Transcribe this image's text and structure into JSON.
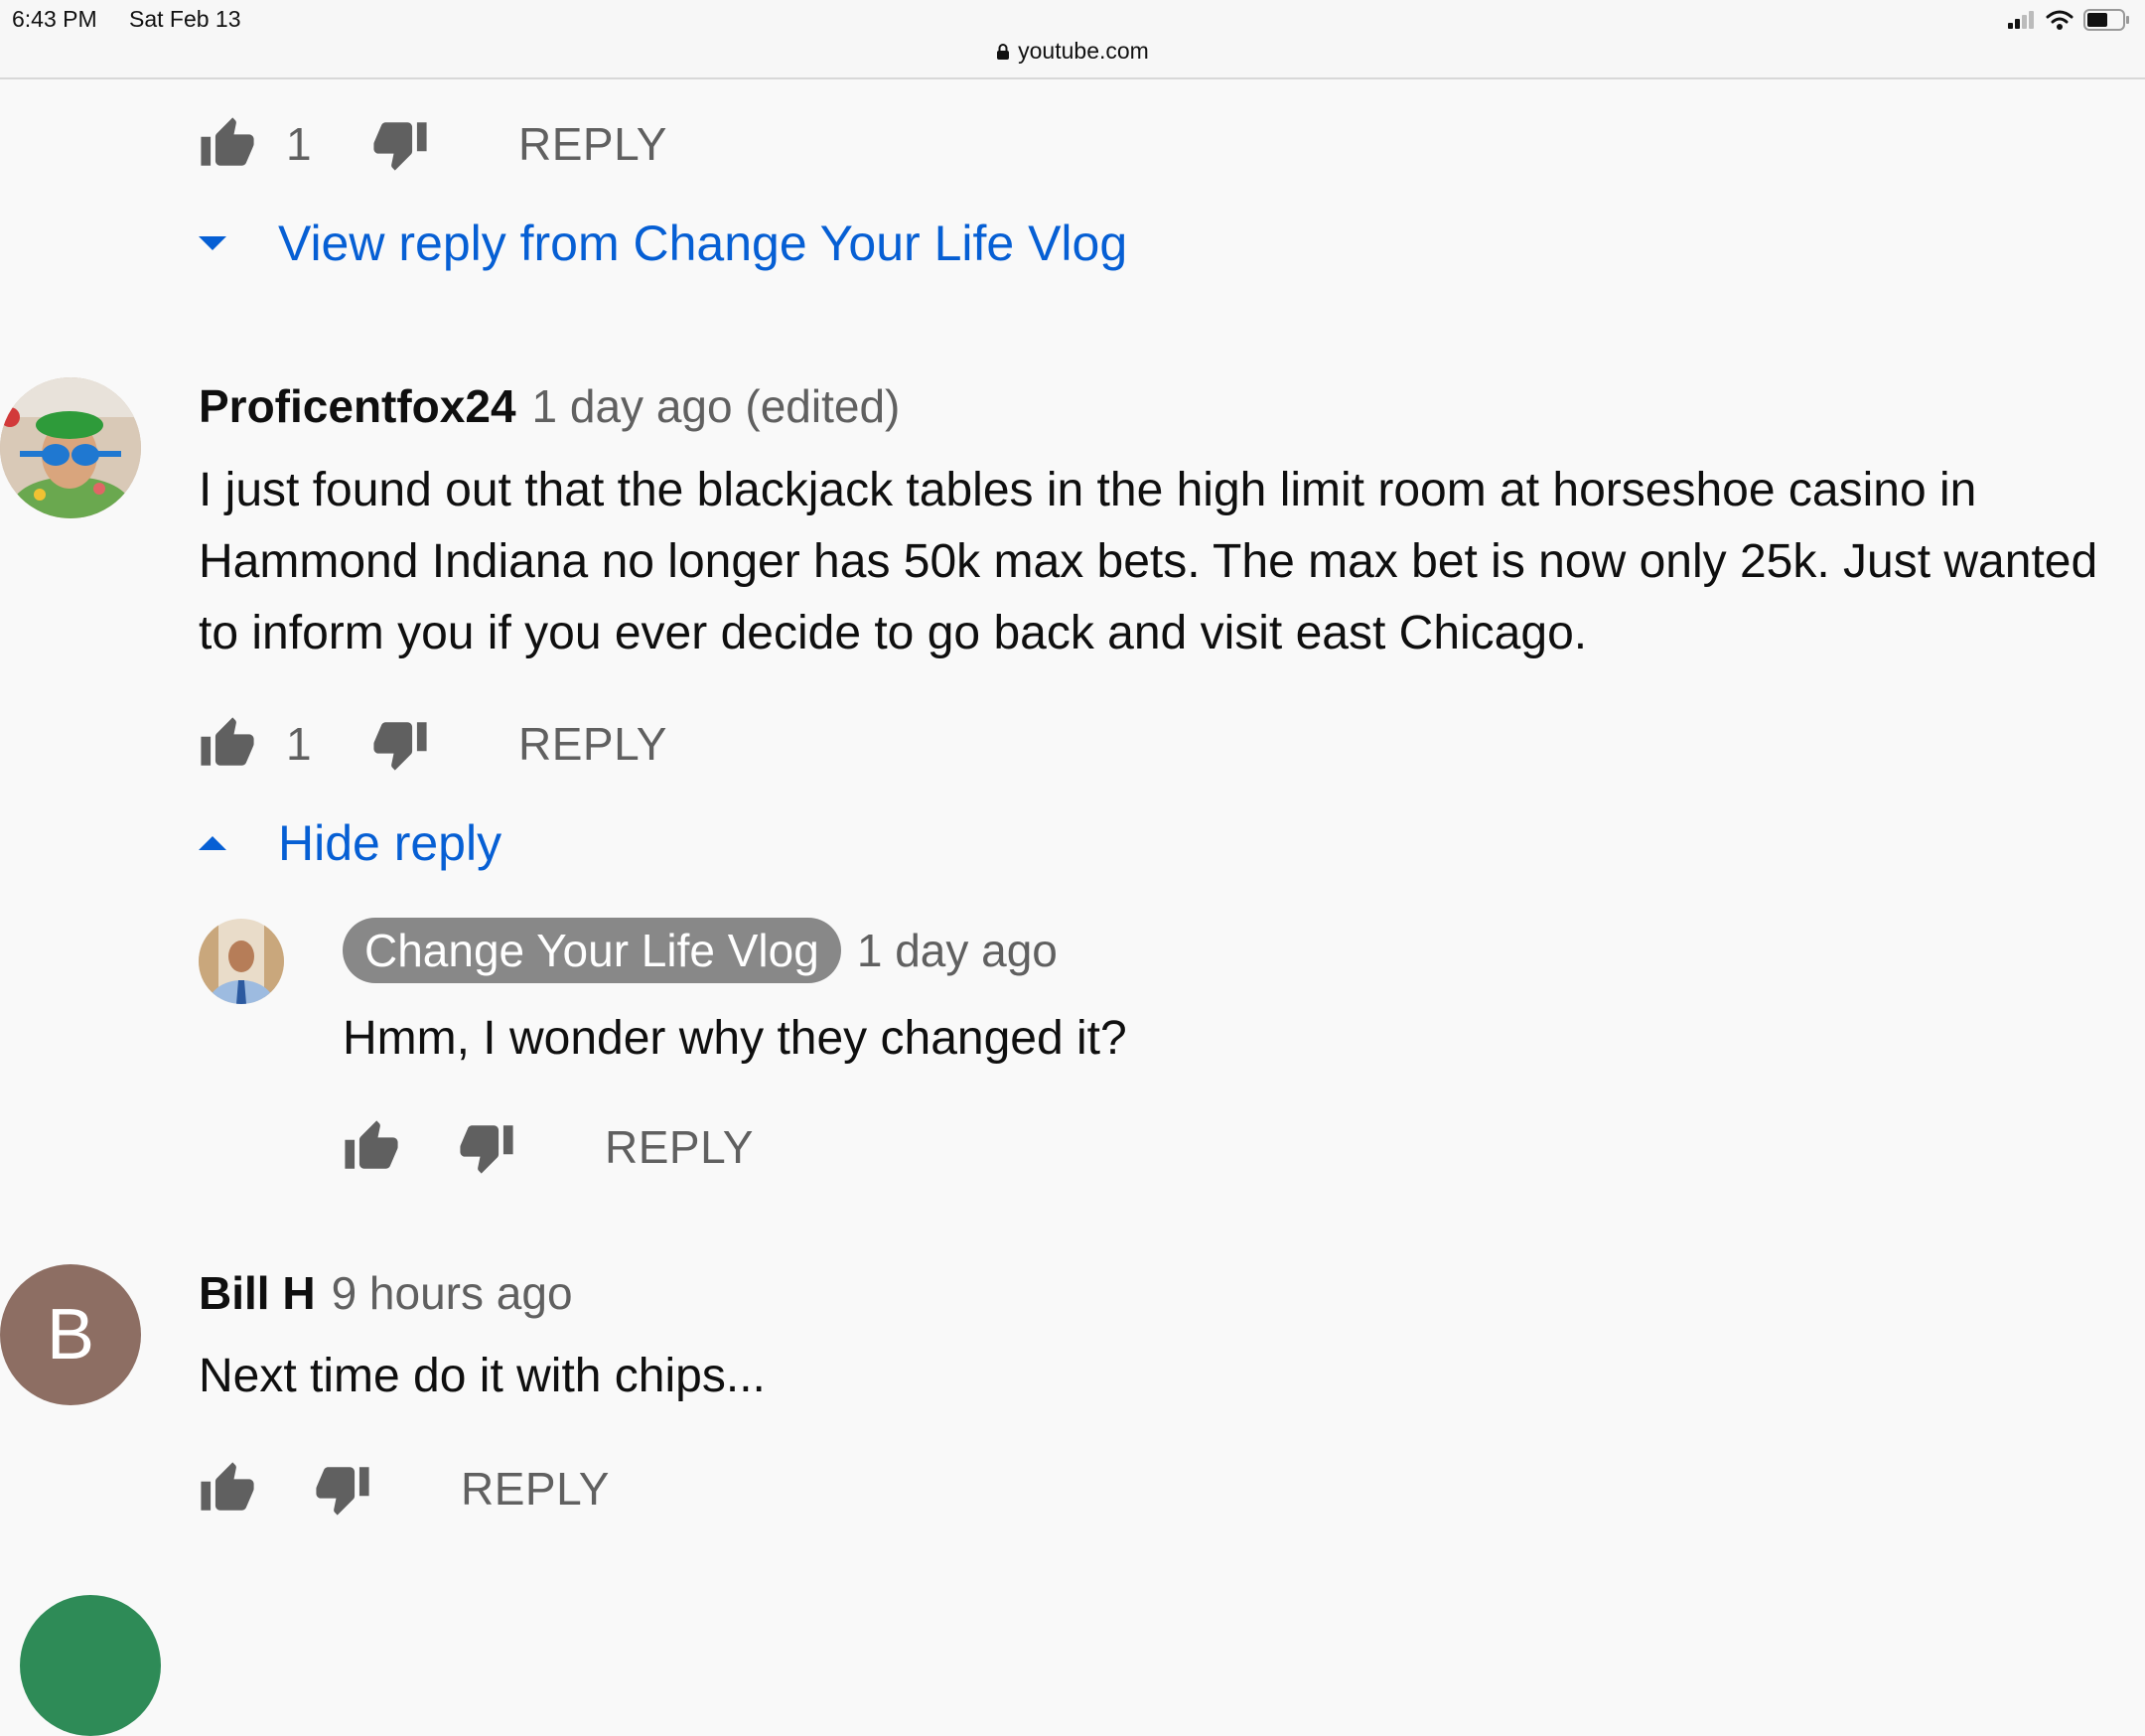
{
  "status_bar": {
    "time": "6:43 PM",
    "date": "Sat Feb 13",
    "url": "youtube.com"
  },
  "comment_prev": {
    "likes": "1",
    "reply_label": "REPLY",
    "view_reply_label": "View reply from Change Your Life Vlog"
  },
  "comment_fox": {
    "author": "Proficentfox24",
    "meta": "1 day ago (edited)",
    "text": "I just found out that the blackjack tables in the high limit room at horseshoe casino in Hammond Indiana no longer has 50k max bets. The max bet is now only 25k. Just wanted to inform you if you ever decide to go back and visit east Chicago.",
    "likes": "1",
    "reply_label": "REPLY",
    "hide_reply_label": "Hide reply"
  },
  "reply_owner": {
    "author": "Change Your Life Vlog",
    "meta": "1 day ago",
    "text": "Hmm, I wonder why they changed it?",
    "reply_label": "REPLY"
  },
  "comment_bill": {
    "author": "Bill H",
    "meta": "9 hours ago",
    "avatar_letter": "B",
    "avatar_color": "#8d6e63",
    "text": "Next time do it with chips...",
    "reply_label": "REPLY"
  },
  "colors": {
    "link_blue": "#065fd4",
    "secondary_text": "#606060",
    "owner_badge": "#888888"
  }
}
